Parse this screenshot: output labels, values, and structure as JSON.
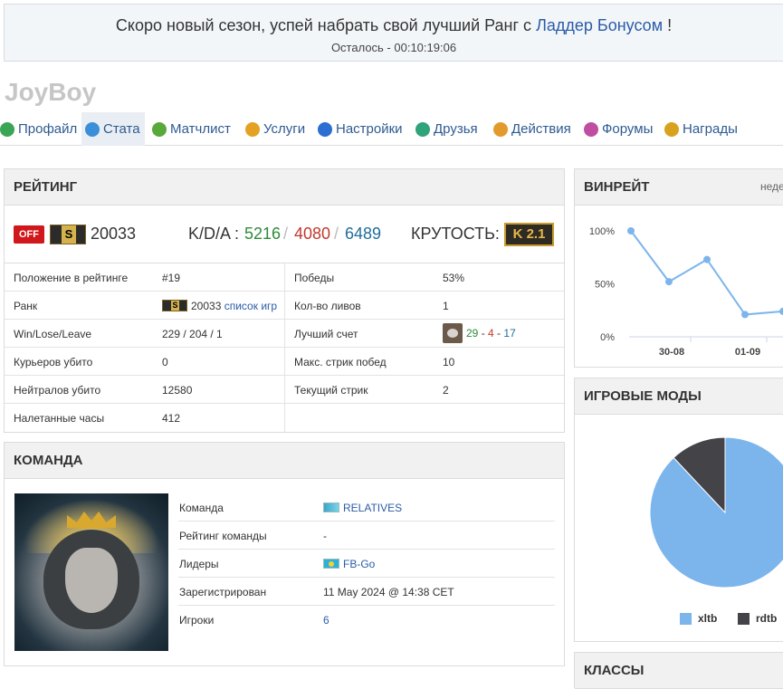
{
  "banner": {
    "message_prefix": "Скоро новый сезон, успей набрать свой лучший Ранг с ",
    "message_link": "Ладдер Бонусом",
    "message_suffix": " !",
    "timer_text": "Осталось - 00:10:19:06"
  },
  "profile": {
    "username": "JoyBoy"
  },
  "nav": {
    "items": [
      {
        "label": "Профайл",
        "icon": "profile-icon",
        "color": "#3aa655",
        "active": false
      },
      {
        "label": "Стата",
        "icon": "stats-icon",
        "color": "#3b8ed8",
        "active": true
      },
      {
        "label": "Матчлист",
        "icon": "matchlist-icon",
        "color": "#58a83a",
        "active": false
      },
      {
        "label": "Услуги",
        "icon": "services-icon",
        "color": "#e3a224",
        "active": false
      },
      {
        "label": "Настройки",
        "icon": "settings-icon",
        "color": "#2a6fd1",
        "active": false
      },
      {
        "label": "Друзья",
        "icon": "friends-icon",
        "color": "#2fa37a",
        "active": false
      },
      {
        "label": "Действия",
        "icon": "actions-icon",
        "color": "#e39a2c",
        "active": false
      },
      {
        "label": "Форумы",
        "icon": "forums-icon",
        "color": "#c04ea0",
        "active": false
      },
      {
        "label": "Награды",
        "icon": "awards-icon",
        "color": "#d8a21f",
        "active": false
      }
    ]
  },
  "rating": {
    "title": "РЕЙТИНГ",
    "status_badge": "OFF",
    "rank_letter": "S",
    "rating_value": "20033",
    "kda_label": "K/D/A :",
    "kills": "5216",
    "deaths": "4080",
    "assists": "6489",
    "separator": "/",
    "coolness_label": "КРУТОСТЬ:",
    "coolness_badge": "K 2.1",
    "stats": [
      {
        "l1": "Положение в рейтинге",
        "v1": "#19",
        "l2": "Победы",
        "v2": "53%"
      },
      {
        "l1": "Ранк",
        "v1": "20033",
        "v1_link": "список игр",
        "l2": "Кол-во ливов",
        "v2": "1"
      },
      {
        "l1": "Win/Lose/Leave",
        "v1": "229 / 204 / 1",
        "l2": "Лучший счет",
        "best_k": "29",
        "best_d": "4",
        "best_a": "17"
      },
      {
        "l1": "Курьеров убито",
        "v1": "0",
        "l2": "Макс. стрик побед",
        "v2": "10"
      },
      {
        "l1": "Нейтралов убито",
        "v1": "12580",
        "l2": "Текущий стрик",
        "v2": "2"
      },
      {
        "l1": "Налетанные часы",
        "v1": "412",
        "l2": "",
        "v2": ""
      }
    ]
  },
  "team": {
    "title": "КОМАНДА",
    "rows": [
      {
        "label": "Команда",
        "value": "RELATIVES",
        "link": true,
        "flag": "team-flag-icon"
      },
      {
        "label": "Рейтинг команды",
        "value": "-",
        "link": false
      },
      {
        "label": "Лидеры",
        "value": "FB-Go",
        "link": true,
        "flag": "kazakhstan-flag-icon"
      },
      {
        "label": "Зарегистрирован",
        "value": "11 May 2024 @ 14:38 CET",
        "link": false
      },
      {
        "label": "Игроки",
        "value": "6",
        "link": true
      }
    ]
  },
  "winrate": {
    "title": "ВИНРЕЙТ",
    "tab_hint": "неде",
    "chart_data": {
      "type": "line",
      "title": "",
      "y_ticks": [
        "100%",
        "0%",
        "50%"
      ],
      "x_ticks": [
        "30-08",
        "01-09"
      ],
      "ylim": [
        0,
        100
      ],
      "series": [
        {
          "values": [
            100,
            52,
            73,
            21,
            24
          ]
        }
      ],
      "line_color": "#7cb5ec"
    }
  },
  "game_modes": {
    "title": "ИГРОВЫЕ МОДЫ",
    "chart_data": {
      "type": "pie",
      "title": "",
      "slices": [
        {
          "name": "xltb",
          "value": 88,
          "color": "#7cb5ec"
        },
        {
          "name": "rdtb",
          "value": 12,
          "color": "#434348"
        }
      ]
    }
  },
  "classes": {
    "title": "КЛАССЫ"
  }
}
